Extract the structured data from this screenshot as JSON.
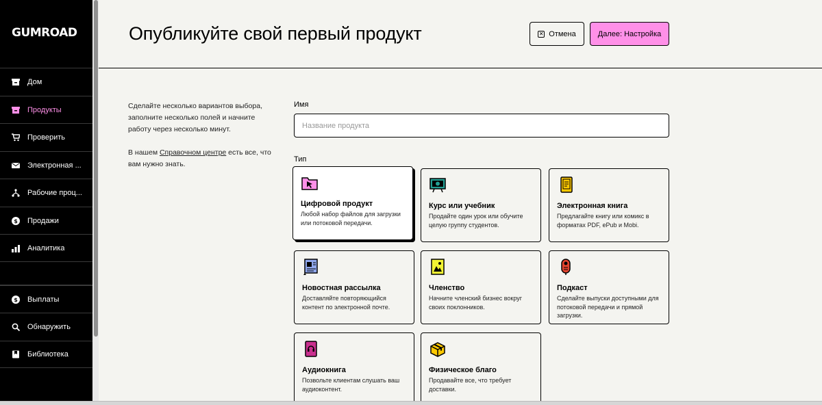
{
  "app": {
    "logo": "GUMROAD"
  },
  "sidebar": {
    "items": [
      {
        "label": "Дом",
        "icon": "home-icon",
        "active": false
      },
      {
        "label": "Продукты",
        "icon": "archive-icon",
        "active": true
      },
      {
        "label": "Проверить",
        "icon": "cart-icon",
        "active": false
      },
      {
        "label": "Электронная ...",
        "icon": "envelope-icon",
        "active": false
      },
      {
        "label": "Рабочие проц...",
        "icon": "workflow-icon",
        "active": false
      },
      {
        "label": "Продажи",
        "icon": "dollar-icon",
        "active": false
      },
      {
        "label": "Аналитика",
        "icon": "bar-chart-icon",
        "active": false
      },
      {
        "label": "Выплаты",
        "icon": "dollar-icon",
        "active": false
      },
      {
        "label": "Обнаружить",
        "icon": "search-icon",
        "active": false
      },
      {
        "label": "Библиотека",
        "icon": "bookmark-icon",
        "active": false
      }
    ]
  },
  "header": {
    "title": "Опубликуйте свой первый продукт",
    "cancel_label": "Отмена",
    "next_label": "Далее: Настройка"
  },
  "intro": {
    "text1": "Сделайте несколько вариантов выбора, заполните несколько полей и начните работу через несколько минут.",
    "text2_before": "В нашем ",
    "text2_link": "Справочном центре",
    "text2_after": " есть все, что вам нужно знать."
  },
  "form": {
    "name_label": "Имя",
    "name_placeholder": "Название продукта",
    "name_value": "",
    "type_label": "Тип"
  },
  "types": [
    {
      "title": "Цифровой продукт",
      "desc": "Любой набор файлов для загрузки или потоковой передачи.",
      "icon": "digital-product-icon",
      "color": "#ff90e8",
      "selected": true
    },
    {
      "title": "Курс или учебник",
      "desc": "Продайте один урок или обучите целую группу студентов.",
      "icon": "course-icon",
      "color": "#23a094",
      "selected": false
    },
    {
      "title": "Электронная книга",
      "desc": "Предлагайте книгу или комикс в форматах PDF, ePub и Mobi.",
      "icon": "ebook-icon",
      "color": "#ffc900",
      "selected": false
    },
    {
      "title": "Новостная рассылка",
      "desc": "Доставляйте повторяющийся контент по электронной почте.",
      "icon": "newsletter-icon",
      "color": "#90a8ed",
      "selected": false
    },
    {
      "title": "Членство",
      "desc": "Начните членский бизнес вокруг своих поклонников.",
      "icon": "membership-icon",
      "color": "#f1f333",
      "selected": false
    },
    {
      "title": "Подкаст",
      "desc": "Сделайте выпуски доступными для потоковой передачи и прямой загрузки.",
      "icon": "podcast-icon",
      "color": "#e2442f",
      "selected": false
    },
    {
      "title": "Аудиокнига",
      "desc": "Позвольте клиентам слушать ваш аудиоконтент.",
      "icon": "audiobook-icon",
      "color": "#c9308e",
      "selected": false
    },
    {
      "title": "Физическое благо",
      "desc": "Продавайте все, что требует доставки.",
      "icon": "physical-good-icon",
      "color": "#ffc900",
      "selected": false
    }
  ]
}
